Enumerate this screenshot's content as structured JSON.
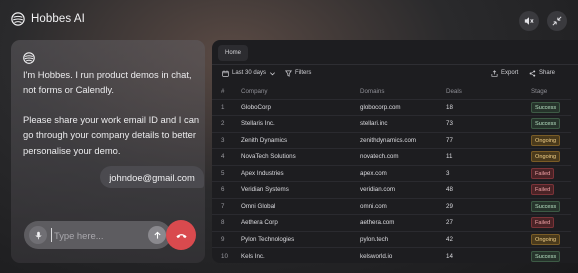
{
  "app": {
    "title": "Hobbes AI"
  },
  "header": {
    "mute_icon": "speaker-muted-icon",
    "collapse_icon": "collapse-arrows-icon"
  },
  "chat": {
    "bot_icon": "hobbes-logo-icon",
    "messages": [
      {
        "role": "assistant",
        "text": "I'm Hobbes. I run product demos in chat, not forms or Calendly."
      },
      {
        "role": "assistant",
        "text": "Please share your work email ID and I can go through your company details to better personalise your demo."
      },
      {
        "role": "user",
        "text": "johndoe@gmail.com"
      }
    ],
    "input": {
      "value": "",
      "placeholder": "Type here..."
    },
    "colors": {
      "hangup": "#d94a4e"
    }
  },
  "dashboard": {
    "tab": "Home",
    "toolbar": {
      "date_filter": "Last 30 days",
      "filters": "Filters",
      "export": "Export",
      "share": "Share"
    },
    "columns": [
      "#",
      "Company",
      "Domains",
      "Deals",
      "Stage"
    ],
    "rows": [
      {
        "num": "1",
        "company": "GloboCorp",
        "domain": "globocorp.com",
        "deals": "18",
        "stage": "Success",
        "status": "success"
      },
      {
        "num": "2",
        "company": "Stellaris Inc.",
        "domain": "stellari.inc",
        "deals": "73",
        "stage": "Success",
        "status": "success"
      },
      {
        "num": "3",
        "company": "Zenith Dynamics",
        "domain": "zenithdynamics.com",
        "deals": "77",
        "stage": "Ongoing",
        "status": "ongoing"
      },
      {
        "num": "4",
        "company": "NovaTech Solutions",
        "domain": "novatech.com",
        "deals": "11",
        "stage": "Ongoing",
        "status": "ongoing"
      },
      {
        "num": "5",
        "company": "Apex Industries",
        "domain": "apex.com",
        "deals": "3",
        "stage": "Failed",
        "status": "failed"
      },
      {
        "num": "6",
        "company": "Veridian Systems",
        "domain": "veridian.com",
        "deals": "48",
        "stage": "Failed",
        "status": "failed"
      },
      {
        "num": "7",
        "company": "Omni Global",
        "domain": "omni.com",
        "deals": "29",
        "stage": "Success",
        "status": "success"
      },
      {
        "num": "8",
        "company": "Aethera Corp",
        "domain": "aethera.com",
        "deals": "27",
        "stage": "Failed",
        "status": "failed"
      },
      {
        "num": "9",
        "company": "Pylon Technologies",
        "domain": "pylon.tech",
        "deals": "42",
        "stage": "Ongoing",
        "status": "ongoing"
      },
      {
        "num": "10",
        "company": "Kels Inc.",
        "domain": "kelsworld.io",
        "deals": "14",
        "stage": "Success",
        "status": "success"
      }
    ]
  }
}
